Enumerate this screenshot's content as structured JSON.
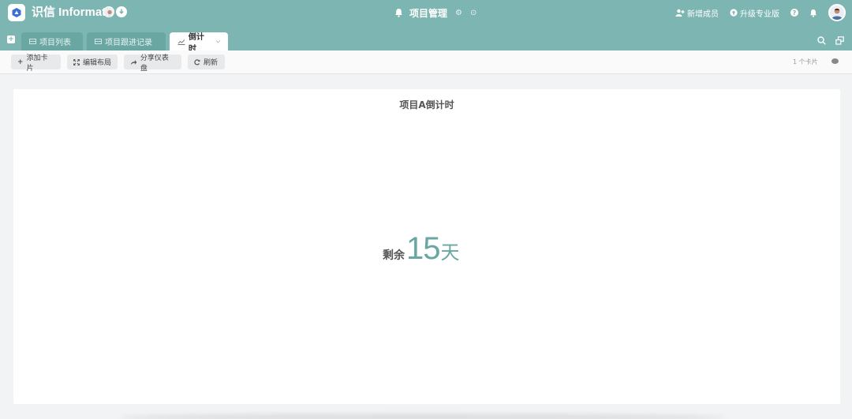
{
  "header": {
    "brand": "识信 Informat",
    "app_title": "项目管理",
    "actions": {
      "add_member": "新增成员",
      "upgrade": "升级专业版"
    }
  },
  "tabs": [
    {
      "label": "项目列表",
      "icon": "table-icon"
    },
    {
      "label": "项目跟进记录",
      "icon": "table-icon"
    },
    {
      "label": "倒计时",
      "icon": "chart-line-icon",
      "active": true
    }
  ],
  "toolbar": {
    "add_card": "添加卡片",
    "edit_layout": "编辑布局",
    "share_dashboard": "分享仪表盘",
    "refresh": "刷新",
    "card_count": "1 个卡片"
  },
  "card": {
    "title": "项目A倒计时",
    "prefix": "剩余",
    "days": "15",
    "unit": "天"
  },
  "colors": {
    "header_bg": "#7cb5b1",
    "accent": "#6aa7a3"
  }
}
